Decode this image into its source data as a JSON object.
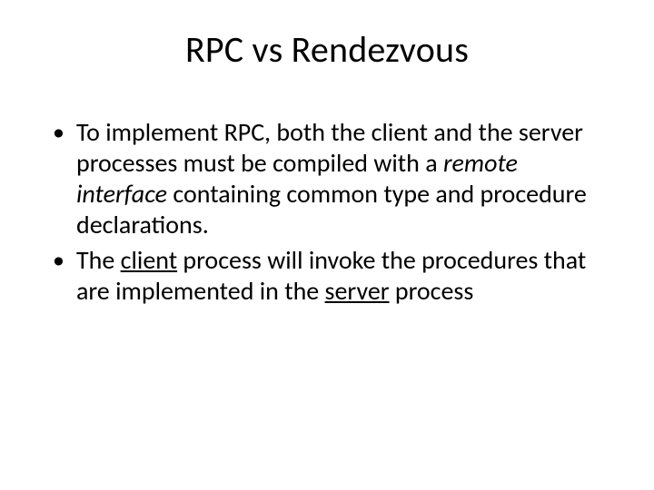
{
  "slide": {
    "title": "RPC vs Rendezvous",
    "bullets": [
      {
        "pre": "To implement RPC, both the client and the server processes must be compiled with a ",
        "em": "remote interface",
        "post": " containing common type and procedure declarations."
      },
      {
        "pre": "The ",
        "u1": "client",
        "mid": " process will invoke the procedures that are implemented in the ",
        "u2": "server",
        "post": " process"
      }
    ]
  }
}
